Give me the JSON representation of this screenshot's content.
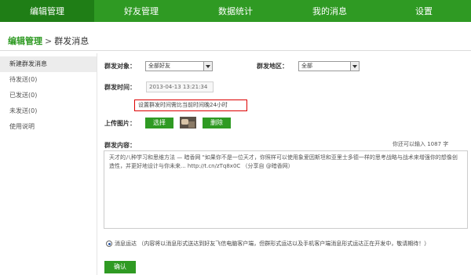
{
  "nav": {
    "tabs": [
      "编辑管理",
      "好友管理",
      "数据统计",
      "我的消息",
      "设置"
    ]
  },
  "breadcrumb": {
    "section": "编辑管理",
    "separator": ">",
    "current": "群发消息"
  },
  "sidebar": {
    "items": [
      "新建群发消息",
      "待发送(0)",
      "已发送(0)",
      "未发送(0)",
      "使用说明"
    ]
  },
  "form": {
    "target_label": "群发对象：",
    "target_value": "全部好友",
    "region_label": "群发地区：",
    "region_value": "全部",
    "time_label": "群发时间：",
    "time_value": "2013-04-13 13:21:34",
    "time_hint": "设置群发时间需比当前时间晚24小时",
    "upload_label": "上传图片：",
    "select_button": "选择",
    "delete_button": "删除",
    "content_label": "群发内容：",
    "counter_text": "你还可以输入 1087 字",
    "content_text": "天才的八种学习和思维方法 — 暗香网 \"如果你不是一位天才，你照样可以使用象爱因斯坦和亚里士多德一样的思考战略与战术来增强你的想像创造性，并更好地设计与你未来... http://t.cn/zTq8x0C （分享自 @暗香网）",
    "notice_text": "消息运达 （内容将以消息形式送达到好友飞信电脑客户端，但群形式运达以及手机客户端消息形式运达正在开发中，敬请期待！）",
    "confirm_button": "确认"
  }
}
